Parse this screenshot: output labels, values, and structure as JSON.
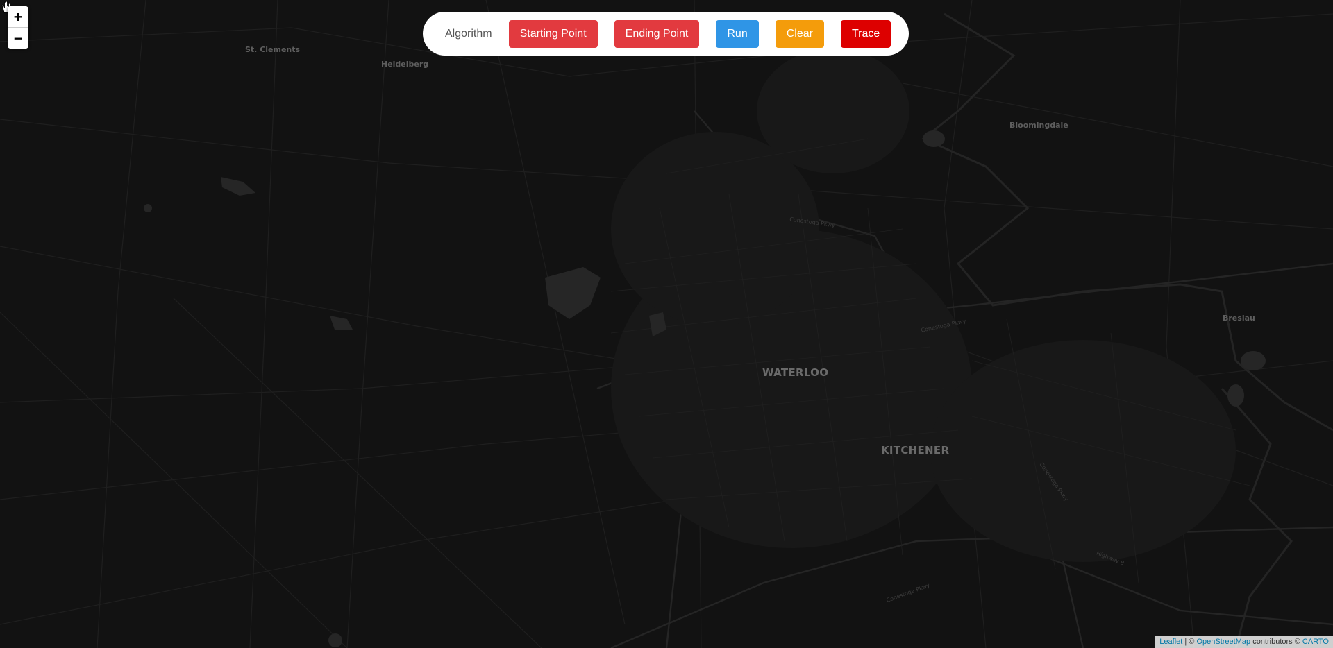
{
  "zoom": {
    "in_label": "+",
    "out_label": "−"
  },
  "toolbar": {
    "algorithm_label": "Algorithm",
    "start_label": "Starting Point",
    "end_label": "Ending Point",
    "run_label": "Run",
    "clear_label": "Clear",
    "trace_label": "Trace"
  },
  "places": {
    "st_clements": "St. Clements",
    "heidelberg": "Heidelberg",
    "bloomingdale": "Bloomingdale",
    "breslau": "Breslau",
    "waterloo": "WATERLOO",
    "kitchener": "KITCHENER"
  },
  "roads": {
    "conestoga_1": "Conestoga Pkwy",
    "conestoga_2": "Conestoga Pkwy",
    "conestoga_3": "Conestoga Pkwy",
    "conestoga_4": "Conestoga Pkwy",
    "highway_8": "Highway 8"
  },
  "attribution": {
    "leaflet": "Leaflet",
    "sep": "| ©",
    "osm": "OpenStreetMap",
    "contrib": "contributors ©",
    "carto": "CARTO"
  },
  "colors": {
    "map_bg": "#121212",
    "start": "#e23a3f",
    "end": "#e23a3f",
    "run": "#2f95e6",
    "clear": "#f49c0b",
    "trace": "#dd0000"
  }
}
